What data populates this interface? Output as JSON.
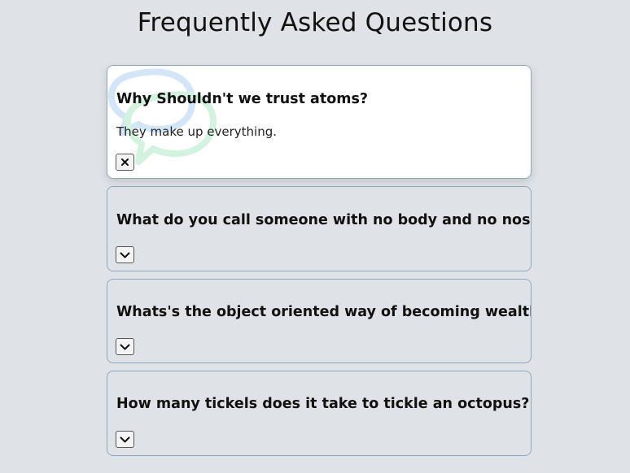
{
  "page": {
    "title": "Frequently Asked Questions"
  },
  "faqs": [
    {
      "question": "Why Shouldn't we trust atoms?",
      "answer": "They make up everything.",
      "expanded": true,
      "toggle_icon": "close-icon"
    },
    {
      "question": "What do you call someone with no body and no nose?",
      "expanded": false,
      "toggle_icon": "chevron-down-icon"
    },
    {
      "question": "Whats's the object oriented way of becoming wealthy?",
      "expanded": false,
      "toggle_icon": "chevron-down-icon"
    },
    {
      "question": "How many tickels does it take to tickle an octopus?",
      "expanded": false,
      "toggle_icon": "chevron-down-icon"
    }
  ],
  "colors": {
    "background": "#dfe2e6",
    "card_border": "#8ea8c2",
    "active_card_bg": "#ffffff",
    "bubble_blue": "#d3e6f8",
    "bubble_green": "#d3f2df"
  }
}
